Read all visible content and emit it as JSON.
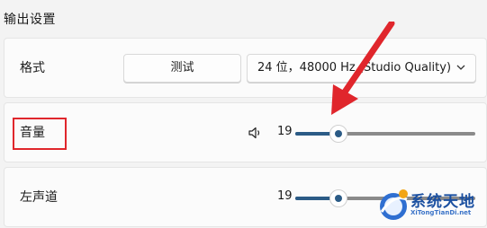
{
  "section_title": "输出设置",
  "format": {
    "label": "格式",
    "test_button": "测试",
    "selected": "24 位，48000 Hz (Studio Quality)"
  },
  "volume": {
    "label": "音量",
    "value": "19",
    "level": 0.19,
    "speaker_icon": "speaker-icon"
  },
  "left_channel": {
    "label": "左声道",
    "value": "19",
    "level": 0.19
  },
  "annotation": {
    "highlight_color": "#e0262c",
    "arrow_color": "#e0262c"
  },
  "watermark": {
    "text": "系统天地",
    "sub": "XiTongTianDi.net"
  },
  "colors": {
    "accent": "#2b5b86",
    "background": "#f3f3f3",
    "card": "#fbfbfb"
  }
}
